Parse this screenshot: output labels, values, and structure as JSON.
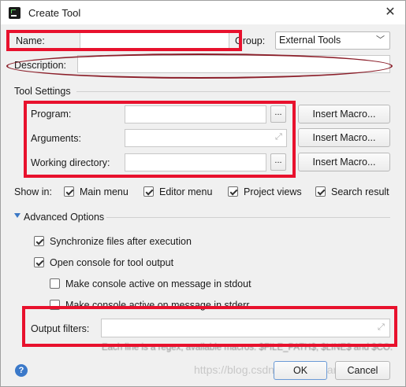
{
  "window": {
    "title": "Create Tool",
    "close_icon": "close-icon"
  },
  "form": {
    "name_label": "Name:",
    "name_value": "",
    "group_label": "Group:",
    "group_value": "External Tools",
    "description_label": "Description:",
    "description_value": ""
  },
  "tool_settings": {
    "section_label": "Tool Settings",
    "program_label": "Program:",
    "program_value": "",
    "arguments_label": "Arguments:",
    "arguments_value": "",
    "working_dir_label": "Working directory:",
    "working_dir_value": "",
    "browse_label": "...",
    "insert_macro_label": "Insert Macro..."
  },
  "show_in": {
    "label": "Show in:",
    "options": [
      {
        "label": "Main menu",
        "checked": true
      },
      {
        "label": "Editor menu",
        "checked": true
      },
      {
        "label": "Project views",
        "checked": true
      },
      {
        "label": "Search result",
        "checked": true
      }
    ]
  },
  "advanced": {
    "section_label": "Advanced Options",
    "options": [
      {
        "label": "Synchronize files after execution",
        "checked": true
      },
      {
        "label": "Open console for tool output",
        "checked": true
      },
      {
        "label": "Make console active on message in stdout",
        "checked": false
      },
      {
        "label": "Make console active on message in stderr",
        "checked": false
      }
    ],
    "output_filters_label": "Output filters:",
    "output_filters_value": "",
    "hint_text": "Each line is a regex, available macros: $FILE_PATH$, $LINE$ and $CO..."
  },
  "footer": {
    "help_label": "?",
    "watermark": "https://blog.csdn.net/gulaixiangjuejue",
    "ok_label": "OK",
    "cancel_label": "Cancel"
  },
  "colors": {
    "annotation_red": "#e8112d",
    "accent_blue": "#3b79c9"
  }
}
